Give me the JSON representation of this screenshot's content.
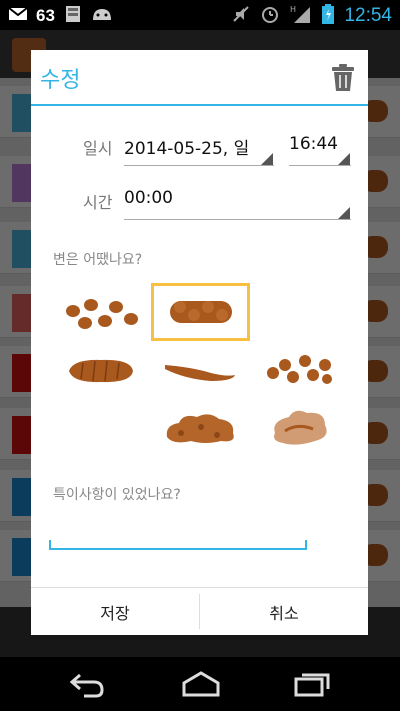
{
  "status_bar": {
    "notification_count": "63",
    "clock": "12:54",
    "icons": [
      "gmail-icon",
      "sd-card-icon",
      "android-icon",
      "mute-icon",
      "alarm-icon",
      "hspa-signal-icon",
      "battery-icon"
    ]
  },
  "dialog": {
    "title": "수정",
    "date_label": "일시",
    "date_value": "2014-05-25, 일",
    "time_value": "16:44",
    "duration_label": "시간",
    "duration_value": "00:00",
    "stool_question": "변은 어땠나요?",
    "stool_types": [
      {
        "name": "separate-hard-lumps",
        "selected": false
      },
      {
        "name": "lumpy-sausage",
        "selected": true
      },
      {
        "name": "cracked-sausage",
        "selected": false
      },
      {
        "name": "smooth-snake",
        "selected": false
      },
      {
        "name": "soft-blobs",
        "selected": false
      },
      {
        "name": "fluffy-pieces",
        "selected": false
      },
      {
        "name": "watery",
        "selected": false
      }
    ],
    "note_placeholder": "특이사항이 있었나요?",
    "note_value": "",
    "save_label": "저장",
    "cancel_label": "취소"
  },
  "colors": {
    "accent": "#33b5e5",
    "selection": "#f7c042",
    "stool": "#a9581e"
  }
}
